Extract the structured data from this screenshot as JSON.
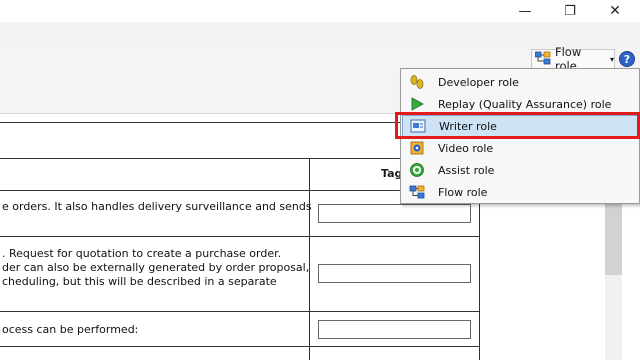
{
  "window": {
    "minimize_glyph": "—",
    "maximize_glyph": "❐",
    "close_glyph": "✕"
  },
  "role_selector": {
    "label": "Flow role",
    "icon": "flow-role-icon",
    "caret": "▾",
    "help_glyph": "?"
  },
  "role_menu": {
    "items": [
      {
        "label": "Developer role",
        "icon": "developer-role-icon"
      },
      {
        "label": "Replay (Quality Assurance) role",
        "icon": "replay-role-icon"
      },
      {
        "label": "Writer role",
        "icon": "writer-role-icon",
        "selected": true
      },
      {
        "label": "Video role",
        "icon": "video-role-icon"
      },
      {
        "label": "Assist role",
        "icon": "assist-role-icon"
      },
      {
        "label": "Flow role",
        "icon": "flow-role-icon"
      }
    ]
  },
  "document": {
    "tag_header": "Tag",
    "rows": [
      {
        "lines": [
          "e orders. It also handles delivery surveillance and sends"
        ]
      },
      {
        "lines": [
          ". Request for quotation to create a purchase order.",
          "der can also be externally generated by order proposal,",
          "cheduling, but this will be described in a separate"
        ]
      },
      {
        "lines": [
          "ocess can be performed:"
        ]
      }
    ]
  },
  "colors": {
    "highlight_border": "#e11b1b",
    "selected_item_bg": "#cfe3f7"
  }
}
